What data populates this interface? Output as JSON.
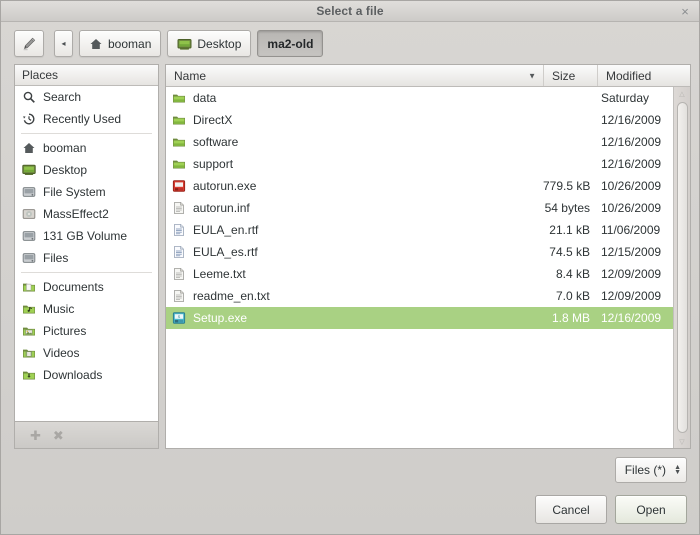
{
  "window": {
    "title": "Select a file",
    "close_label": "×",
    "close_icon": "close-icon"
  },
  "pathbar": {
    "type_name_icon": "pencil-edit-icon",
    "back_icon": "◂",
    "crumbs": [
      {
        "label": "booman",
        "icon": "home-icon",
        "active": false
      },
      {
        "label": "Desktop",
        "icon": "desktop-icon",
        "active": false
      },
      {
        "label": "ma2-old",
        "icon": "none",
        "active": true
      }
    ]
  },
  "sidebar": {
    "header": "Places",
    "items": [
      {
        "label": "Search",
        "icon": "search-icon"
      },
      {
        "label": "Recently Used",
        "icon": "history-icon"
      },
      {
        "separator": true
      },
      {
        "label": "booman",
        "icon": "home-icon"
      },
      {
        "label": "Desktop",
        "icon": "desktop-icon"
      },
      {
        "label": "File System",
        "icon": "drive-icon"
      },
      {
        "label": "MassEffect2",
        "icon": "disc-icon"
      },
      {
        "label": "131 GB Volume",
        "icon": "drive-icon"
      },
      {
        "label": "Files",
        "icon": "drive-icon"
      },
      {
        "separator": true
      },
      {
        "label": "Documents",
        "icon": "folder-documents-icon"
      },
      {
        "label": "Music",
        "icon": "folder-music-icon"
      },
      {
        "label": "Pictures",
        "icon": "folder-pictures-icon"
      },
      {
        "label": "Videos",
        "icon": "folder-videos-icon"
      },
      {
        "label": "Downloads",
        "icon": "folder-downloads-icon"
      }
    ],
    "add_label": "✚",
    "remove_label": "✖"
  },
  "filelist": {
    "columns": [
      "Name",
      "Size",
      "Modified"
    ],
    "sort_arrow": "▼",
    "rows": [
      {
        "name": "data",
        "size": "",
        "modified": "Saturday",
        "icon": "folder-icon",
        "selected": false
      },
      {
        "name": "DirectX",
        "size": "",
        "modified": "12/16/2009",
        "icon": "folder-icon",
        "selected": false
      },
      {
        "name": "software",
        "size": "",
        "modified": "12/16/2009",
        "icon": "folder-icon",
        "selected": false
      },
      {
        "name": "support",
        "size": "",
        "modified": "12/16/2009",
        "icon": "folder-icon",
        "selected": false
      },
      {
        "name": "autorun.exe",
        "size": "779.5 kB",
        "modified": "10/26/2009",
        "icon": "exe-icon",
        "selected": false
      },
      {
        "name": "autorun.inf",
        "size": "54 bytes",
        "modified": "10/26/2009",
        "icon": "document-icon",
        "selected": false
      },
      {
        "name": "EULA_en.rtf",
        "size": "21.1 kB",
        "modified": "11/06/2009",
        "icon": "rtf-icon",
        "selected": false
      },
      {
        "name": "EULA_es.rtf",
        "size": "74.5 kB",
        "modified": "12/15/2009",
        "icon": "rtf-icon",
        "selected": false
      },
      {
        "name": "Leeme.txt",
        "size": "8.4 kB",
        "modified": "12/09/2009",
        "icon": "document-icon",
        "selected": false
      },
      {
        "name": "readme_en.txt",
        "size": "7.0 kB",
        "modified": "12/09/2009",
        "icon": "document-icon",
        "selected": false
      },
      {
        "name": "Setup.exe",
        "size": "1.8 MB",
        "modified": "12/16/2009",
        "icon": "setup-exe-icon",
        "selected": true
      }
    ],
    "selection_color": "#a9d183",
    "scrollbar": {
      "up_arrow": "△",
      "down_arrow": "▽"
    }
  },
  "footer": {
    "filter": {
      "value": "Files (*)",
      "up": "▲",
      "down": "▼"
    },
    "cancel_label": "Cancel",
    "open_label": "Open"
  }
}
